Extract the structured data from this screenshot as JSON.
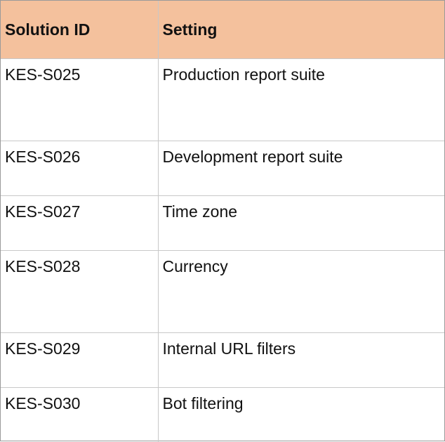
{
  "table": {
    "headers": {
      "solution_id": "Solution ID",
      "setting": "Setting"
    },
    "rows": [
      {
        "solution_id": "KES-S025",
        "setting": "Production report suite"
      },
      {
        "solution_id": "KES-S026",
        "setting": "Development report suite"
      },
      {
        "solution_id": "KES-S027",
        "setting": "Time zone"
      },
      {
        "solution_id": "KES-S028",
        "setting": "Currency"
      },
      {
        "solution_id": "KES-S029",
        "setting": "Internal URL filters"
      },
      {
        "solution_id": "KES-S030",
        "setting": "Bot filtering"
      }
    ]
  },
  "colors": {
    "header_background": "#f4c19d",
    "grid_line": "#c8c8c8",
    "text": "#111111"
  }
}
